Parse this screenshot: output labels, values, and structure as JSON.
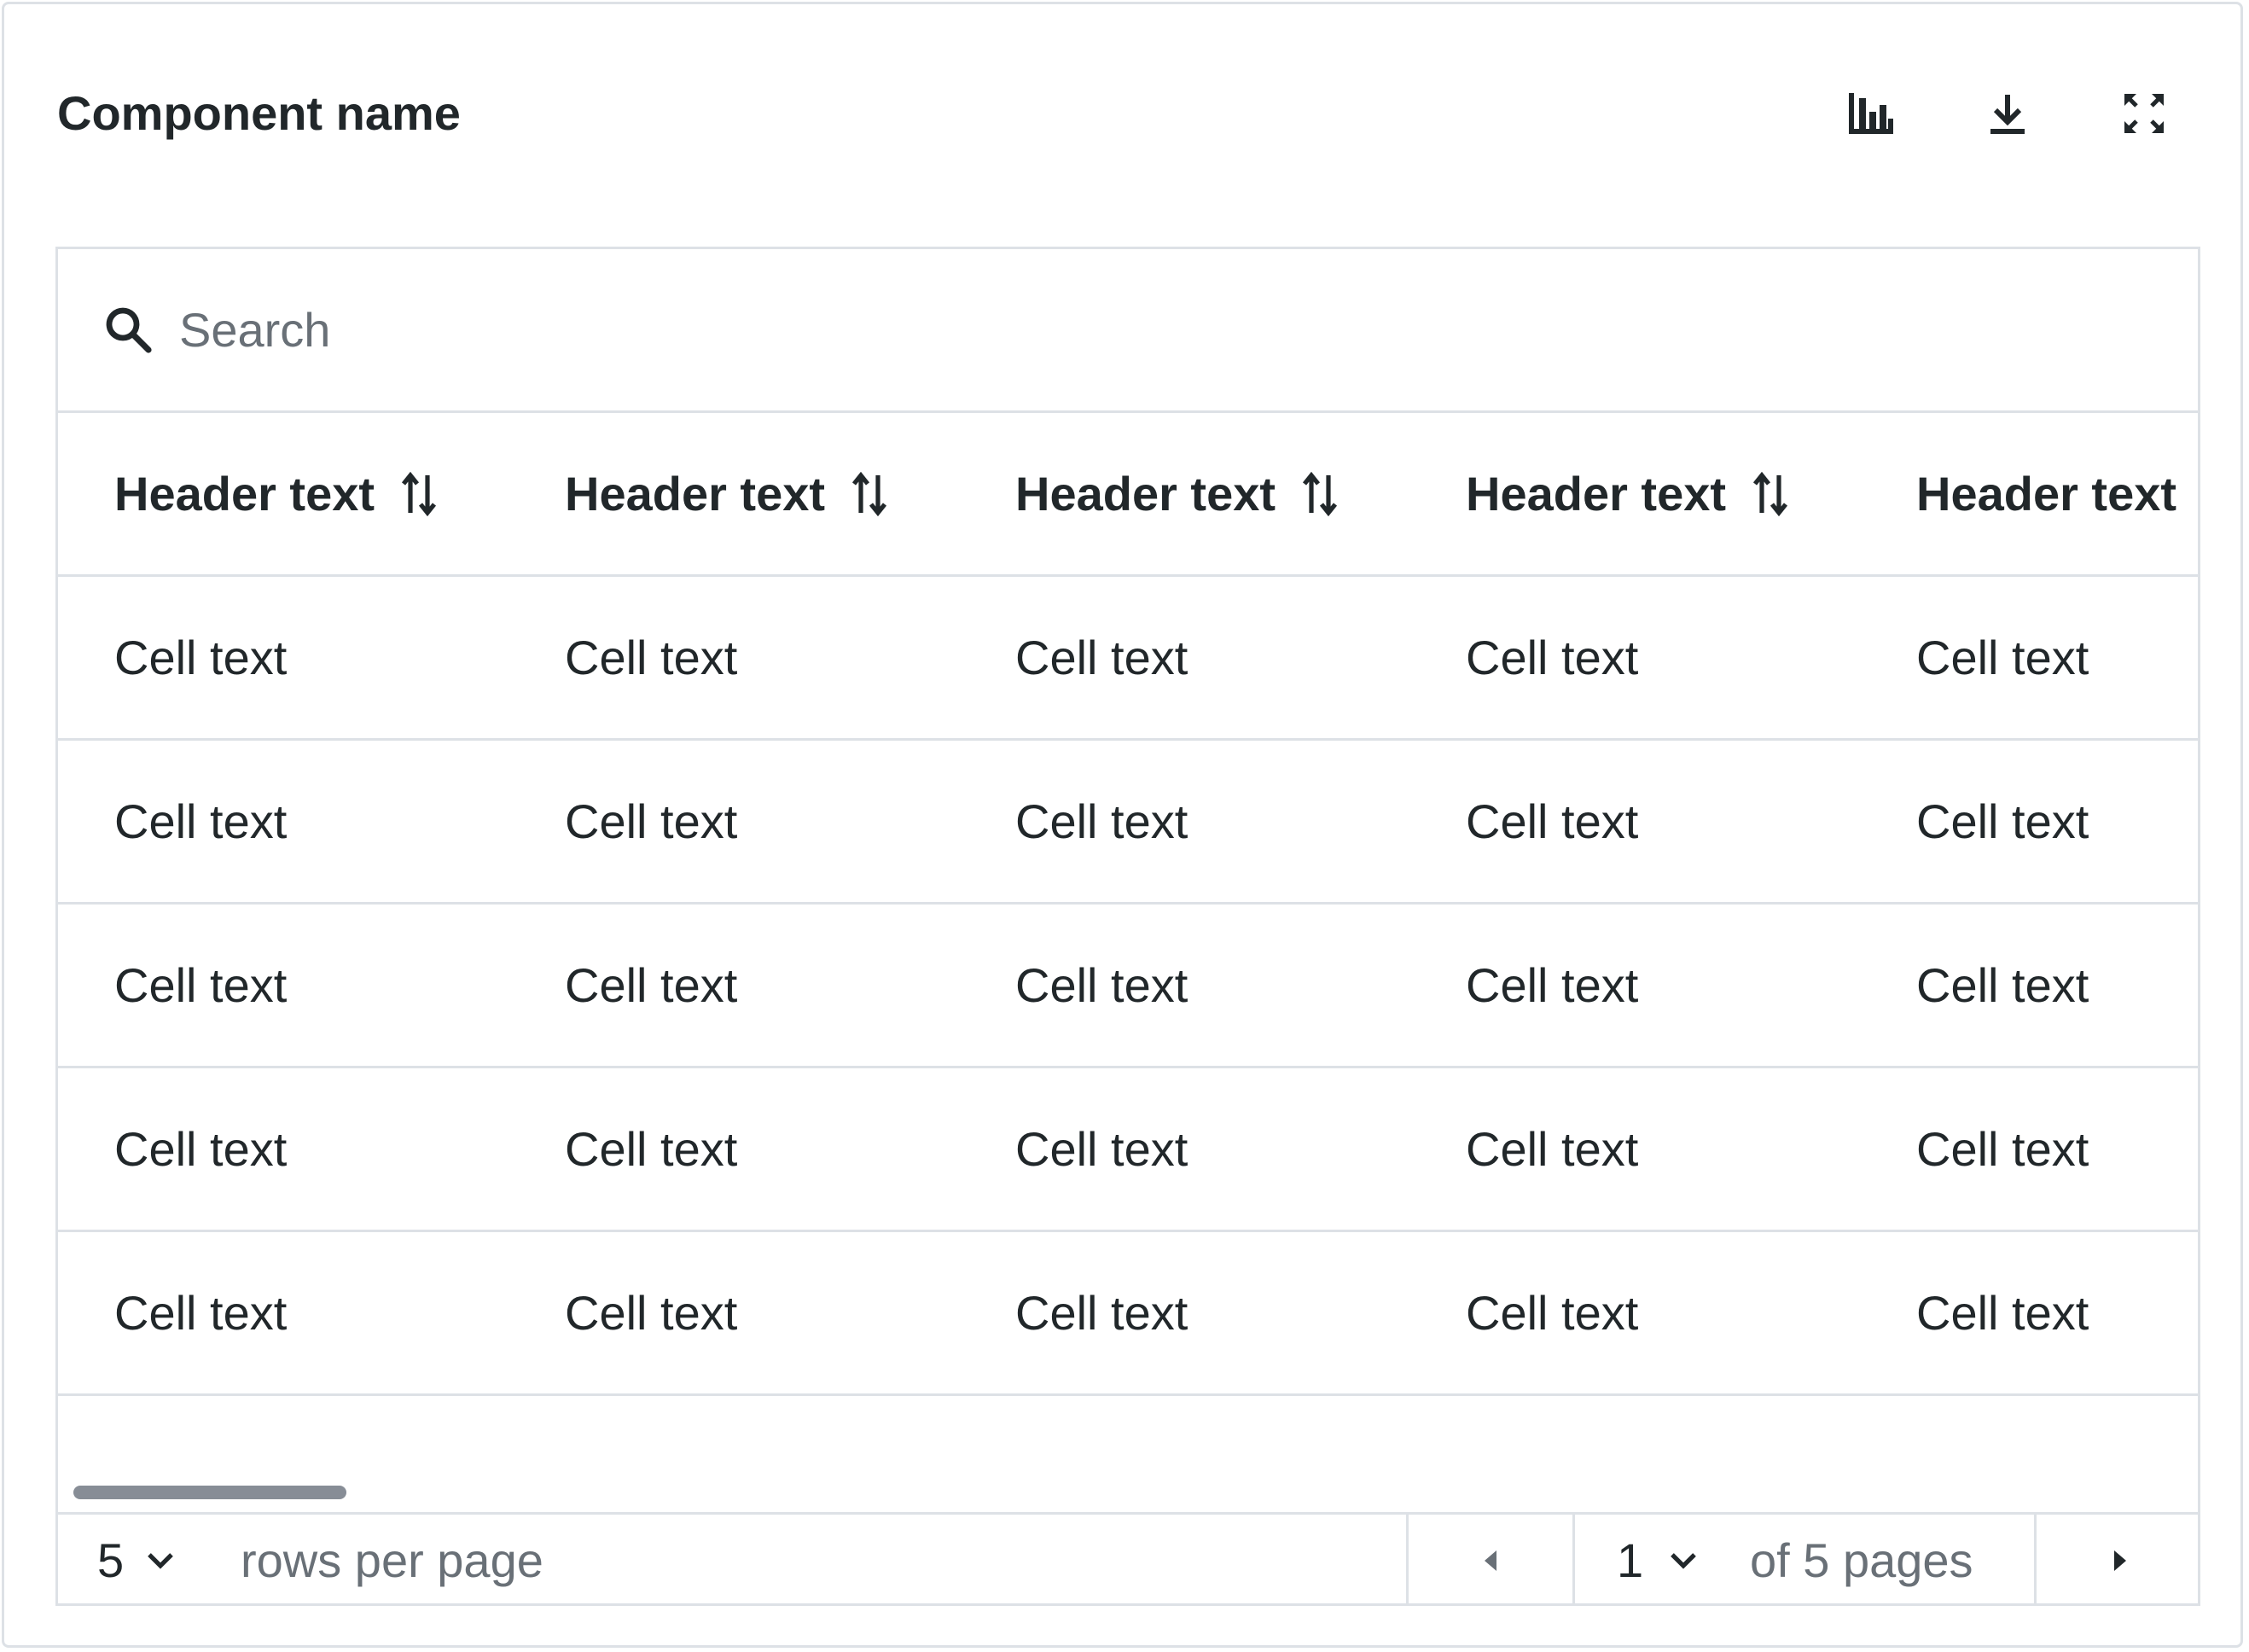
{
  "component": {
    "title": "Component name"
  },
  "toolbar": {
    "chart_icon": "bar-chart-icon",
    "download_icon": "download-icon",
    "fullscreen_icon": "maximize-icon"
  },
  "search": {
    "placeholder": "Search",
    "value": ""
  },
  "table": {
    "headers": [
      "Header text",
      "Header text",
      "Header text",
      "Header text",
      "Header text"
    ],
    "rows": [
      [
        "Cell text",
        "Cell text",
        "Cell text",
        "Cell text",
        "Cell text"
      ],
      [
        "Cell text",
        "Cell text",
        "Cell text",
        "Cell text",
        "Cell text"
      ],
      [
        "Cell text",
        "Cell text",
        "Cell text",
        "Cell text",
        "Cell text"
      ],
      [
        "Cell text",
        "Cell text",
        "Cell text",
        "Cell text",
        "Cell text"
      ],
      [
        "Cell text",
        "Cell text",
        "Cell text",
        "Cell text",
        "Cell text"
      ]
    ]
  },
  "pagination": {
    "rows_per_page_value": "5",
    "rows_per_page_label": "rows per page",
    "current_page": "1",
    "pages_label": "of 5 pages"
  },
  "colors": {
    "border": "#dde1e6",
    "text": "#21272a",
    "muted_text": "#697077",
    "scroll_thumb": "#878d96"
  }
}
